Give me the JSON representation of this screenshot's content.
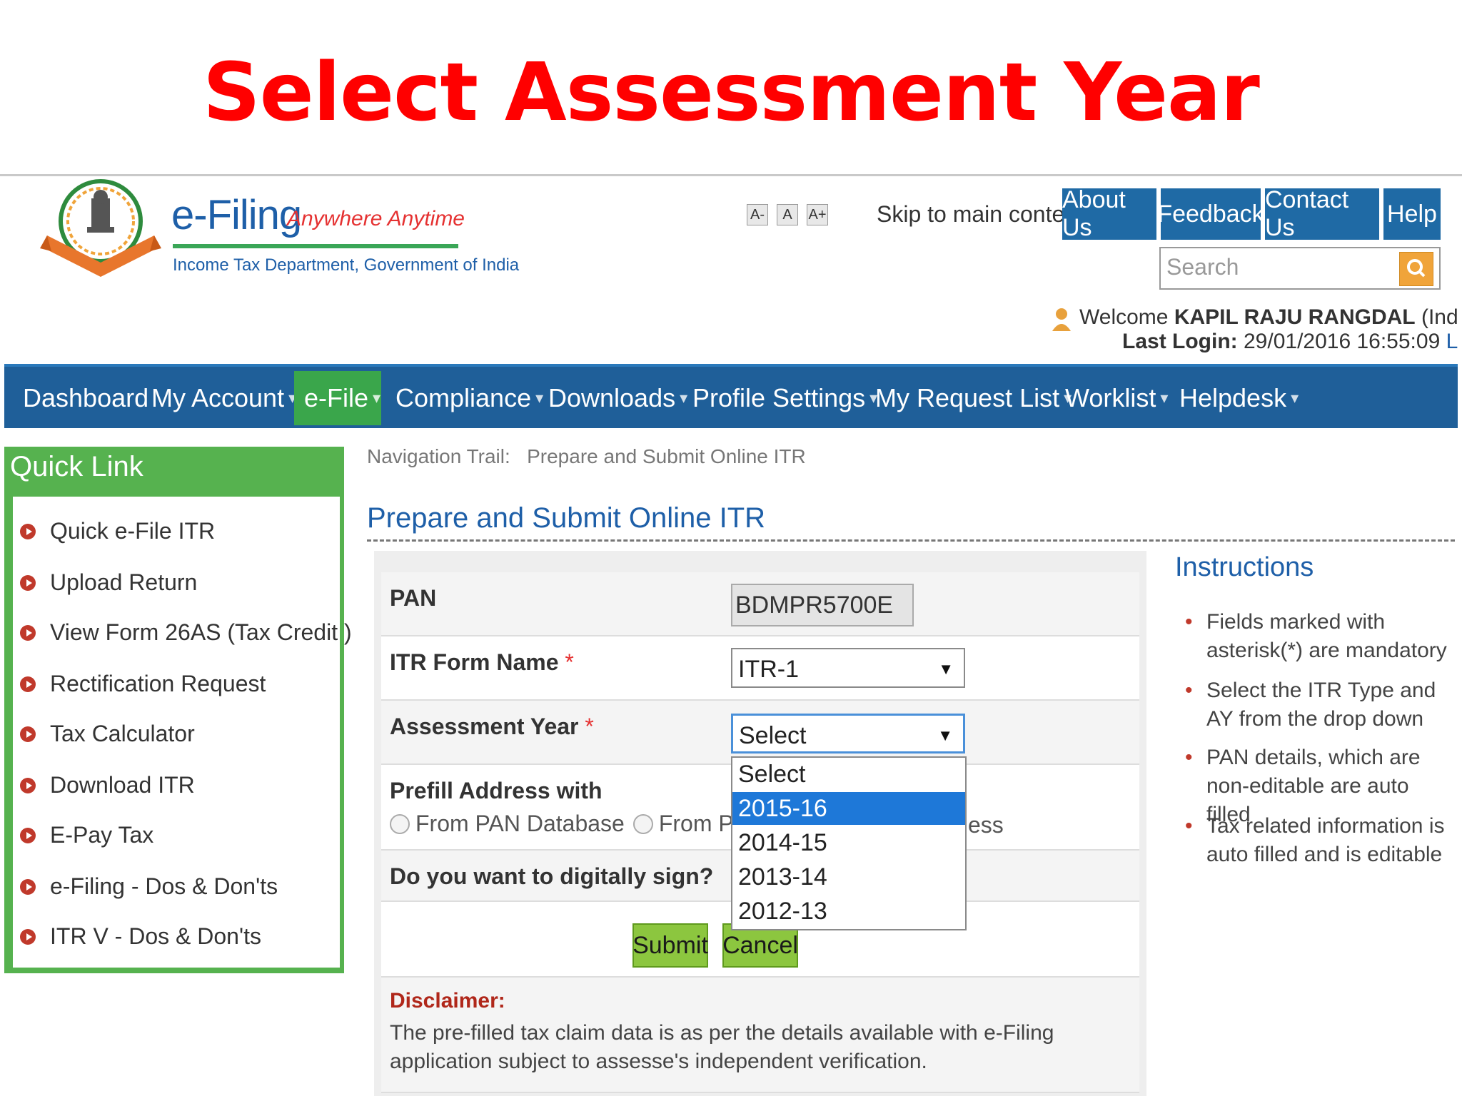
{
  "slide": {
    "title": "Select Assessment Year"
  },
  "header": {
    "brand": "e-Filing",
    "tagline": "Anywhere Anytime",
    "department": "Income Tax Department, Government of India",
    "font_sizes": [
      "A-",
      "A",
      "A+"
    ],
    "skip_link": "Skip to main content",
    "top_links": [
      "About Us",
      "Feedback",
      "Contact Us",
      "Help"
    ],
    "search_placeholder": "Search",
    "welcome_prefix": "Welcome",
    "user_name": "KAPIL RAJU RANGDAL",
    "user_type": "(Individual)",
    "last_login_label": "Last Login:",
    "last_login_value": "29/01/2016 16:55:09",
    "logout": "Logout"
  },
  "main_nav": [
    "Dashboard",
    "My Account",
    "e-File",
    "Compliance",
    "Downloads",
    "Profile Settings",
    "My Request List",
    "Worklist",
    "Helpdesk"
  ],
  "quick_link": {
    "title": "Quick Link",
    "items": [
      "Quick e-File ITR",
      "Upload Return",
      "View Form 26AS (Tax Credit )",
      "Rectification Request",
      "Tax Calculator",
      "Download ITR",
      "E-Pay Tax",
      "e-Filing - Dos & Don'ts",
      "ITR V - Dos & Don'ts"
    ]
  },
  "content": {
    "trail_label": "Navigation Trail:",
    "trail_value": "Prepare and Submit Online ITR",
    "heading": "Prepare and Submit Online ITR",
    "pan_label": "PAN",
    "pan_value": "BDMPR5700E",
    "itr_label": "ITR Form Name",
    "itr_value": "ITR-1",
    "ay_label": "Assessment Year",
    "ay_value": "Select",
    "ay_options": [
      "Select",
      "2015-16",
      "2014-15",
      "2013-14",
      "2012-13"
    ],
    "ay_highlighted": "2015-16",
    "prefill_label": "Prefill Address with",
    "prefill_opt1": "From PAN Database",
    "prefill_opt2": "From Previou",
    "prefill_opt3_tail": "ess",
    "sign_label": "Do you want to digitally sign?",
    "submit": "Submit",
    "cancel": "Cancel",
    "disclaimer_title": "Disclaimer:",
    "disclaimer_text": "The pre-filled tax claim data is as per the details available with e-Filing application subject to assesse's independent verification.",
    "required_mark": "*"
  },
  "instructions": {
    "title": "Instructions",
    "items": [
      "Fields marked with asterisk(*) are mandatory",
      "Select the ITR Type and AY from the drop down",
      "PAN details, which are non-editable are auto filled",
      "Tax related information is auto filled and is editable"
    ]
  }
}
